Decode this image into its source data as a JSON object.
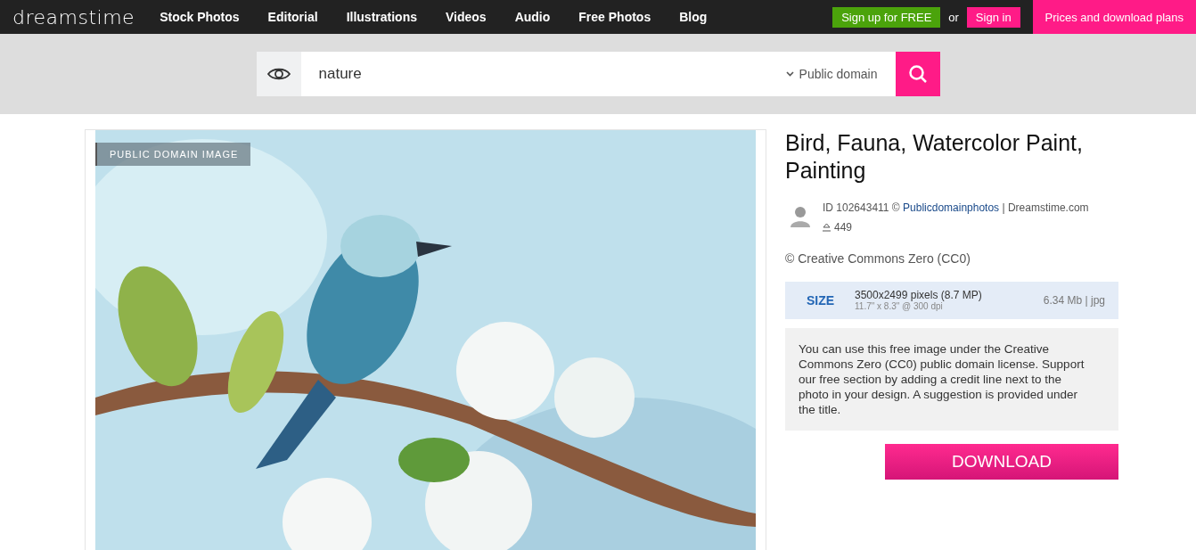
{
  "nav": {
    "logo": "dreamstime",
    "links": [
      "Stock Photos",
      "Editorial",
      "Illustrations",
      "Videos",
      "Audio",
      "Free Photos",
      "Blog"
    ],
    "signup": "Sign up for FREE",
    "or": "or",
    "signin": "Sign in",
    "plans": "Prices and download plans"
  },
  "search": {
    "value": "nature",
    "filter": "Public domain"
  },
  "image": {
    "kind": "picture",
    "badge": "PUBLIC DOMAIN IMAGE"
  },
  "details": {
    "title": "Bird, Fauna, Watercolor Paint, Painting",
    "id_prefix": "ID 102643411 ©",
    "author": "Publicdomainphotos",
    "id_suffix": "| Dreamstime.com",
    "downloads": "449",
    "license": "© Creative Commons Zero (CC0)",
    "size": {
      "label": "SIZE",
      "pixels": "3500x2499 pixels (8.7 MP)",
      "print": "11.7\" x 8.3\" @ 300 dpi",
      "file": "6.34 Mb | jpg"
    },
    "notice": "You can use this free image under the Creative Commons Zero (CC0) public domain license. Support our free section by adding a credit line next to the photo in your design. A suggestion is provided under the title.",
    "download": "DOWNLOAD"
  }
}
